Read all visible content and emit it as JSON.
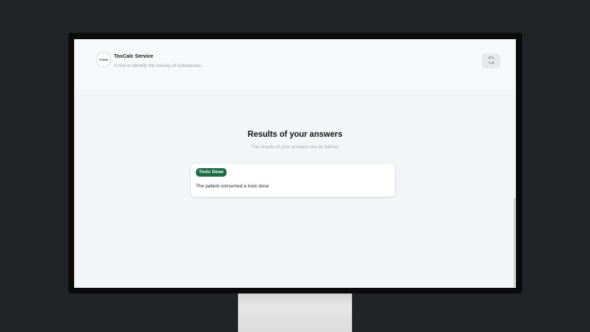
{
  "header": {
    "logo_text": "ToxCalc",
    "title": "ToxCalc Service",
    "subtitle": "A tool to identify the toxicity of substances"
  },
  "actions": {
    "refresh_icon": "refresh-icon"
  },
  "results": {
    "title": "Results of your answers",
    "subtitle": "The results of your answers are as follows",
    "card": {
      "badge": "Toxic Dose",
      "text": "The patient consumed a toxic dose"
    }
  },
  "colors": {
    "badge_bg": "#1d6b45",
    "page_bg": "#f4f5f7",
    "desktop_bg": "#212327"
  }
}
